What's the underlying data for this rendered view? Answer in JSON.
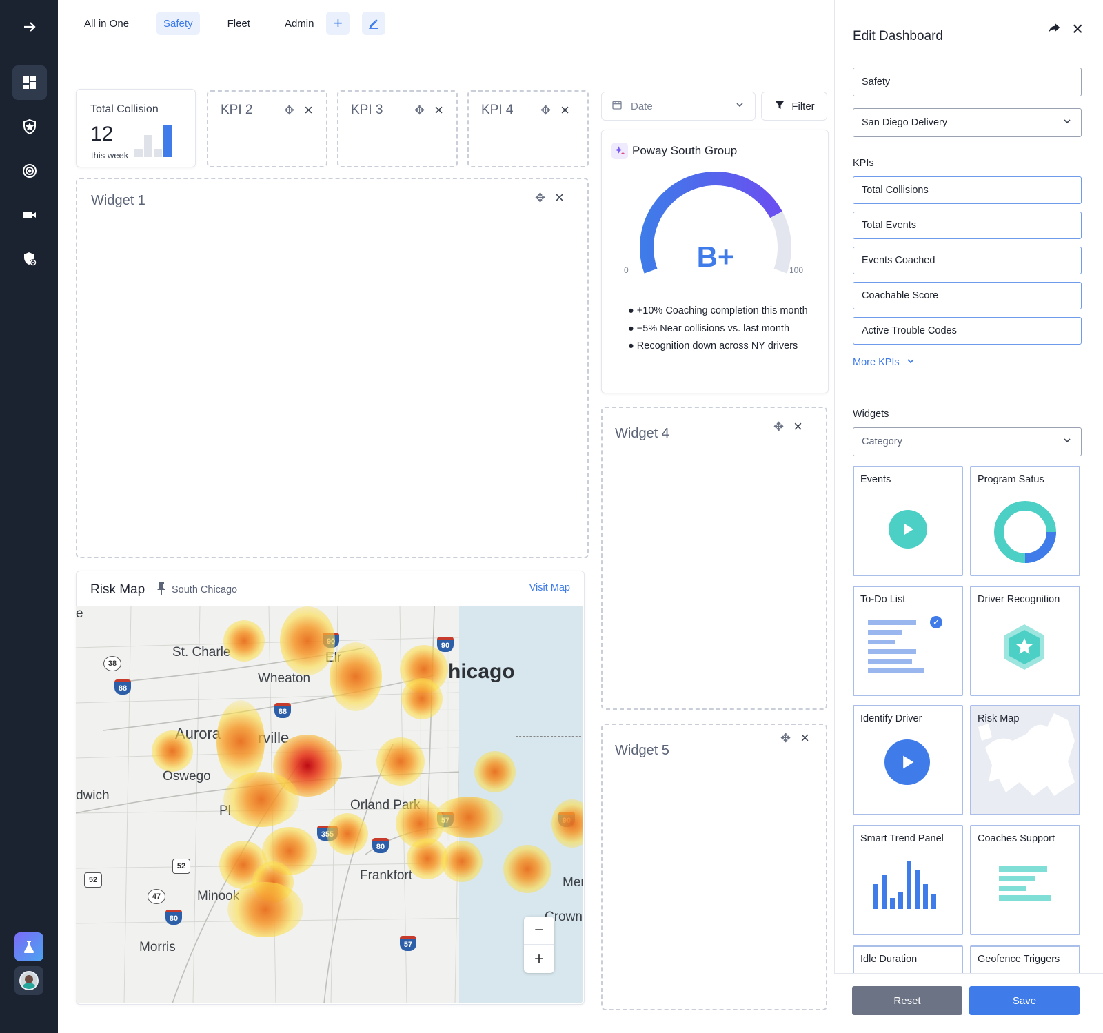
{
  "tabs": [
    {
      "label": "All in One"
    },
    {
      "label": "Safety"
    },
    {
      "label": "Fleet"
    },
    {
      "label": "Admin"
    }
  ],
  "kpi_total": {
    "title": "Total Collision",
    "value": "12",
    "sub": "this week"
  },
  "kpi_slots": [
    {
      "title": "KPI 2"
    },
    {
      "title": "KPI 3"
    },
    {
      "title": "KPI 4"
    }
  ],
  "widget1": {
    "title": "Widget 1"
  },
  "widget4": {
    "title": "Widget 4"
  },
  "widget5": {
    "title": "Widget 5"
  },
  "date": {
    "label": "Date"
  },
  "filter": {
    "label": "Filter"
  },
  "score": {
    "group": "Poway South Group",
    "grade": "B+",
    "min": "0",
    "max": "100",
    "level": 0.78,
    "bullets": [
      "+10% Coaching completion this month",
      "−5% Near collisions vs. last month",
      "Recognition down across NY drivers"
    ]
  },
  "risk_map": {
    "title": "Risk Map",
    "location": "South Chicago",
    "visit": "Visit Map",
    "cities": [
      "St. Charle",
      "Wheaton",
      "hicago",
      "Aurora",
      "rville",
      "Oswego",
      "dwich",
      "Orland Park",
      "Frankfort",
      "Minook",
      "Morris",
      "Crown",
      "Mer",
      "e",
      "Pl",
      "Elr"
    ],
    "highways": [
      "38",
      "88",
      "90",
      "88",
      "90",
      "57",
      "90",
      "355",
      "80",
      "52",
      "52",
      "47",
      "80",
      "57"
    ]
  },
  "panel": {
    "title": "Edit Dashboard",
    "dashboard_name": "Safety",
    "location": "San Diego Delivery",
    "kpis_label": "KPIs",
    "kpis": [
      "Total Collisions",
      "Total Events",
      "Events Coached",
      "Coachable Score",
      "Active Trouble Codes"
    ],
    "more_kpis": "More KPIs",
    "widgets_label": "Widgets",
    "category_placeholder": "Category",
    "widgets": [
      "Events",
      "Program Satus",
      "To-Do List",
      "Driver Recognition",
      "Identify Driver",
      "Risk Map",
      "Smart Trend Panel",
      "Coaches Support",
      "Idle Duration",
      "Geofence Triggers"
    ],
    "reset": "Reset",
    "save": "Save"
  },
  "colors": {
    "accent": "#3f7be9",
    "sidebar": "#1b2230",
    "teal": "#4ccfc4"
  }
}
